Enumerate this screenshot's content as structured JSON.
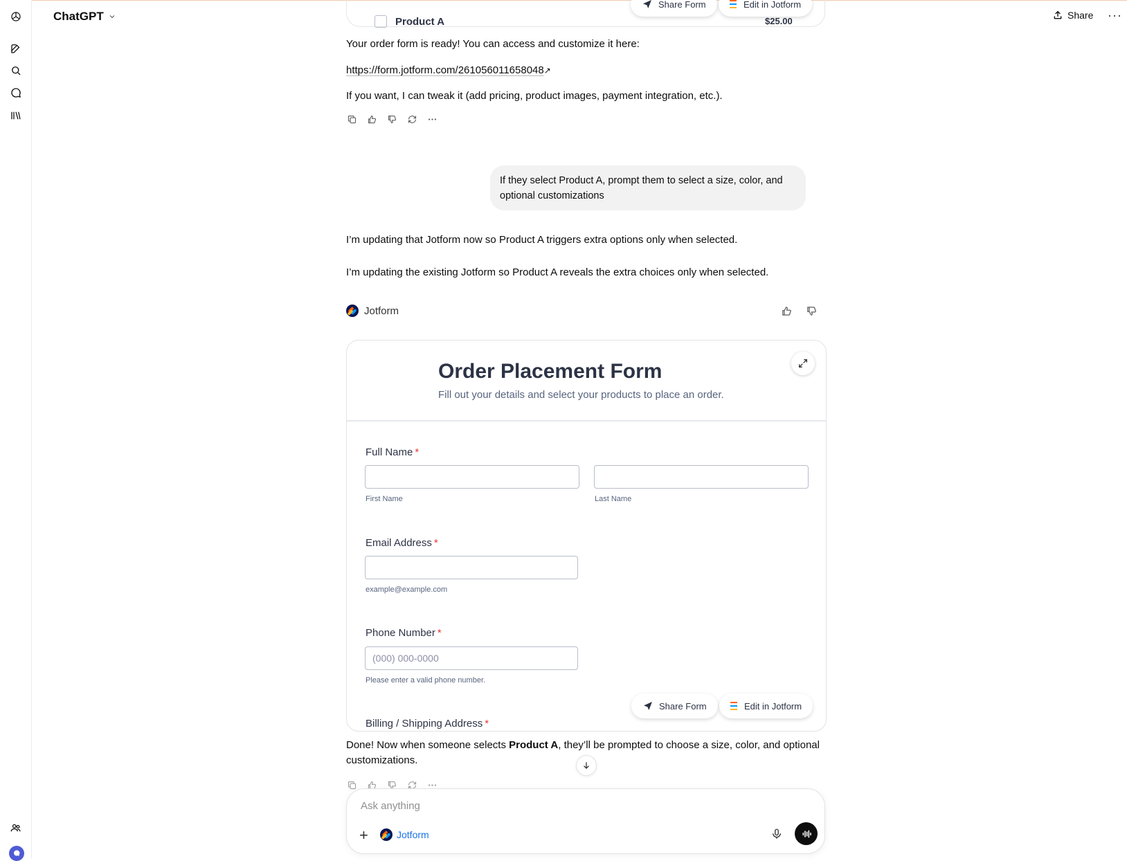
{
  "header": {
    "app_title": "ChatGPT",
    "share_label": "Share",
    "more_label": "···"
  },
  "top_card": {
    "product_label": "Product A",
    "product_price": "$25.00",
    "share_form_label": "Share Form",
    "edit_label": "Edit in Jotform"
  },
  "assistant_msg_1": {
    "line1": "Your order form is ready! You can access and customize it here:",
    "link": "https://form.jotform.com/261056011658048",
    "link_arrow": "↗",
    "line3": "If you want, I can tweak it (add pricing, product images, payment integration, etc.)."
  },
  "user_msg": {
    "text": "If they select Product A, prompt them to select a size, color, and optional customizations"
  },
  "assistant_msg_2": {
    "line1": "I’m updating that Jotform now so Product A triggers extra options only when selected.",
    "line2": "I’m updating the existing Jotform so Product A reveals the extra choices only when selected."
  },
  "app_block": {
    "name": "Jotform"
  },
  "form": {
    "title": "Order Placement Form",
    "subtitle": "Fill out your details and select your products to place an order.",
    "full_name_label": "Full Name",
    "required_mark": "*",
    "first_name_hint": "First Name",
    "last_name_hint": "Last Name",
    "email_label": "Email Address",
    "email_hint": "example@example.com",
    "phone_label": "Phone Number",
    "phone_placeholder": "(000) 000-0000",
    "phone_hint": "Please enter a valid phone number.",
    "address_label": "Billing / Shipping Address",
    "share_form_label": "Share Form",
    "edit_label": "Edit in Jotform"
  },
  "assistant_msg_3": {
    "pre": "Done! Now when someone selects ",
    "bold": "Product A",
    "post": ", they’ll be prompted to choose a size, color, and optional customizations."
  },
  "composer": {
    "placeholder": "Ask anything",
    "plus": "+",
    "tool_label": "Jotform"
  }
}
